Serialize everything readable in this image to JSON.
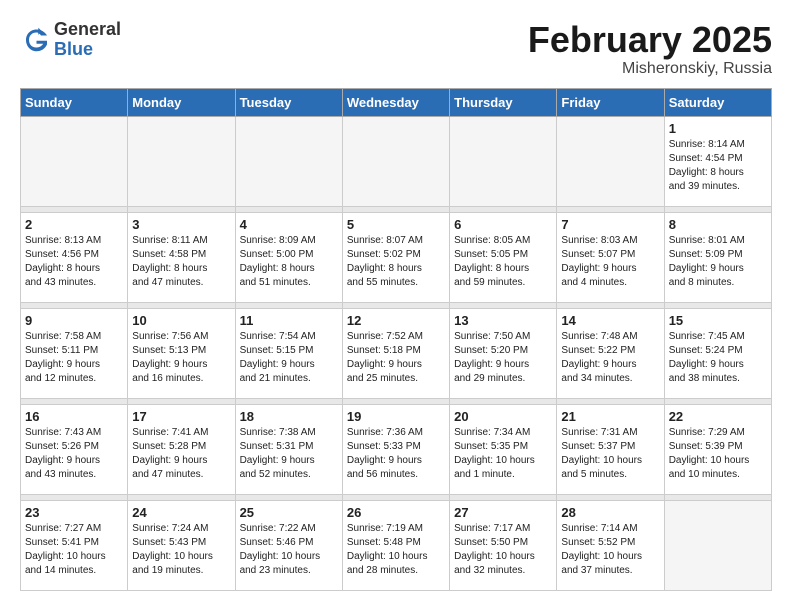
{
  "logo": {
    "line1": "General",
    "line2": "Blue"
  },
  "title": "February 2025",
  "location": "Misheronskiy, Russia",
  "days_header": [
    "Sunday",
    "Monday",
    "Tuesday",
    "Wednesday",
    "Thursday",
    "Friday",
    "Saturday"
  ],
  "weeks": [
    [
      {
        "day": "",
        "info": ""
      },
      {
        "day": "",
        "info": ""
      },
      {
        "day": "",
        "info": ""
      },
      {
        "day": "",
        "info": ""
      },
      {
        "day": "",
        "info": ""
      },
      {
        "day": "",
        "info": ""
      },
      {
        "day": "1",
        "info": "Sunrise: 8:14 AM\nSunset: 4:54 PM\nDaylight: 8 hours\nand 39 minutes."
      }
    ],
    [
      {
        "day": "2",
        "info": "Sunrise: 8:13 AM\nSunset: 4:56 PM\nDaylight: 8 hours\nand 43 minutes."
      },
      {
        "day": "3",
        "info": "Sunrise: 8:11 AM\nSunset: 4:58 PM\nDaylight: 8 hours\nand 47 minutes."
      },
      {
        "day": "4",
        "info": "Sunrise: 8:09 AM\nSunset: 5:00 PM\nDaylight: 8 hours\nand 51 minutes."
      },
      {
        "day": "5",
        "info": "Sunrise: 8:07 AM\nSunset: 5:02 PM\nDaylight: 8 hours\nand 55 minutes."
      },
      {
        "day": "6",
        "info": "Sunrise: 8:05 AM\nSunset: 5:05 PM\nDaylight: 8 hours\nand 59 minutes."
      },
      {
        "day": "7",
        "info": "Sunrise: 8:03 AM\nSunset: 5:07 PM\nDaylight: 9 hours\nand 4 minutes."
      },
      {
        "day": "8",
        "info": "Sunrise: 8:01 AM\nSunset: 5:09 PM\nDaylight: 9 hours\nand 8 minutes."
      }
    ],
    [
      {
        "day": "9",
        "info": "Sunrise: 7:58 AM\nSunset: 5:11 PM\nDaylight: 9 hours\nand 12 minutes."
      },
      {
        "day": "10",
        "info": "Sunrise: 7:56 AM\nSunset: 5:13 PM\nDaylight: 9 hours\nand 16 minutes."
      },
      {
        "day": "11",
        "info": "Sunrise: 7:54 AM\nSunset: 5:15 PM\nDaylight: 9 hours\nand 21 minutes."
      },
      {
        "day": "12",
        "info": "Sunrise: 7:52 AM\nSunset: 5:18 PM\nDaylight: 9 hours\nand 25 minutes."
      },
      {
        "day": "13",
        "info": "Sunrise: 7:50 AM\nSunset: 5:20 PM\nDaylight: 9 hours\nand 29 minutes."
      },
      {
        "day": "14",
        "info": "Sunrise: 7:48 AM\nSunset: 5:22 PM\nDaylight: 9 hours\nand 34 minutes."
      },
      {
        "day": "15",
        "info": "Sunrise: 7:45 AM\nSunset: 5:24 PM\nDaylight: 9 hours\nand 38 minutes."
      }
    ],
    [
      {
        "day": "16",
        "info": "Sunrise: 7:43 AM\nSunset: 5:26 PM\nDaylight: 9 hours\nand 43 minutes."
      },
      {
        "day": "17",
        "info": "Sunrise: 7:41 AM\nSunset: 5:28 PM\nDaylight: 9 hours\nand 47 minutes."
      },
      {
        "day": "18",
        "info": "Sunrise: 7:38 AM\nSunset: 5:31 PM\nDaylight: 9 hours\nand 52 minutes."
      },
      {
        "day": "19",
        "info": "Sunrise: 7:36 AM\nSunset: 5:33 PM\nDaylight: 9 hours\nand 56 minutes."
      },
      {
        "day": "20",
        "info": "Sunrise: 7:34 AM\nSunset: 5:35 PM\nDaylight: 10 hours\nand 1 minute."
      },
      {
        "day": "21",
        "info": "Sunrise: 7:31 AM\nSunset: 5:37 PM\nDaylight: 10 hours\nand 5 minutes."
      },
      {
        "day": "22",
        "info": "Sunrise: 7:29 AM\nSunset: 5:39 PM\nDaylight: 10 hours\nand 10 minutes."
      }
    ],
    [
      {
        "day": "23",
        "info": "Sunrise: 7:27 AM\nSunset: 5:41 PM\nDaylight: 10 hours\nand 14 minutes."
      },
      {
        "day": "24",
        "info": "Sunrise: 7:24 AM\nSunset: 5:43 PM\nDaylight: 10 hours\nand 19 minutes."
      },
      {
        "day": "25",
        "info": "Sunrise: 7:22 AM\nSunset: 5:46 PM\nDaylight: 10 hours\nand 23 minutes."
      },
      {
        "day": "26",
        "info": "Sunrise: 7:19 AM\nSunset: 5:48 PM\nDaylight: 10 hours\nand 28 minutes."
      },
      {
        "day": "27",
        "info": "Sunrise: 7:17 AM\nSunset: 5:50 PM\nDaylight: 10 hours\nand 32 minutes."
      },
      {
        "day": "28",
        "info": "Sunrise: 7:14 AM\nSunset: 5:52 PM\nDaylight: 10 hours\nand 37 minutes."
      },
      {
        "day": "",
        "info": ""
      }
    ]
  ]
}
